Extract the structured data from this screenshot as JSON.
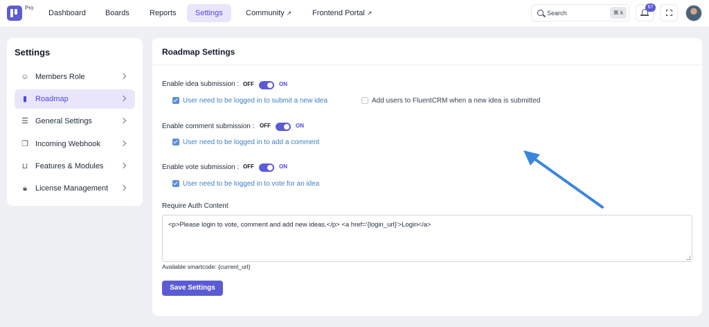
{
  "app": {
    "pro_label": "Pro"
  },
  "nav": {
    "items": [
      {
        "label": "Dashboard"
      },
      {
        "label": "Boards"
      },
      {
        "label": "Reports"
      },
      {
        "label": "Settings"
      },
      {
        "label": "Community",
        "ext": "↗"
      },
      {
        "label": "Frontend Portal",
        "ext": "↗"
      }
    ],
    "active": "Settings"
  },
  "search": {
    "placeholder": "Search",
    "shortcut": "⌘ k"
  },
  "notifications": {
    "count": "67"
  },
  "icons": {
    "bell": "bell-icon",
    "expand": "expand-icon",
    "search": "search-icon"
  },
  "sidebar": {
    "title": "Settings",
    "items": [
      {
        "label": "Members Role",
        "icon": "users-icon"
      },
      {
        "label": "Roadmap",
        "icon": "bar-chart-icon",
        "active": true
      },
      {
        "label": "General Settings",
        "icon": "sliders-icon"
      },
      {
        "label": "Incoming Webhook",
        "icon": "webhook-icon"
      },
      {
        "label": "Features & Modules",
        "icon": "modules-icon"
      },
      {
        "label": "License Management",
        "icon": "lock-icon"
      }
    ]
  },
  "main": {
    "title": "Roadmap Settings",
    "idea": {
      "label": "Enable idea submission :",
      "off": "OFF",
      "on": "ON",
      "enabled": true,
      "login_label": "User need to be logged in to submit a new idea",
      "login_checked": true,
      "crm_label": "Add users to FluentCRM when a new idea is submitted",
      "crm_checked": false
    },
    "comment": {
      "label": "Enable comment submission :",
      "off": "OFF",
      "on": "ON",
      "enabled": true,
      "login_label": "User need to be logged in to add a comment",
      "login_checked": true
    },
    "vote": {
      "label": "Enable vote submission :",
      "off": "OFF",
      "on": "ON",
      "enabled": true,
      "login_label": "User need to be logged in to vote for an idea",
      "login_checked": true
    },
    "auth_content": {
      "label": "Require Auth Content",
      "value": "<p>Please login to vote, comment and add new ideas.</p> <a href='{login_url}'>Login</a>"
    },
    "smartcode": "Available smartcode: {current_url}",
    "save_label": "Save Settings"
  },
  "colors": {
    "accent": "#5b5bd6",
    "link": "#3b82c4",
    "arrow": "#3a85e0"
  }
}
